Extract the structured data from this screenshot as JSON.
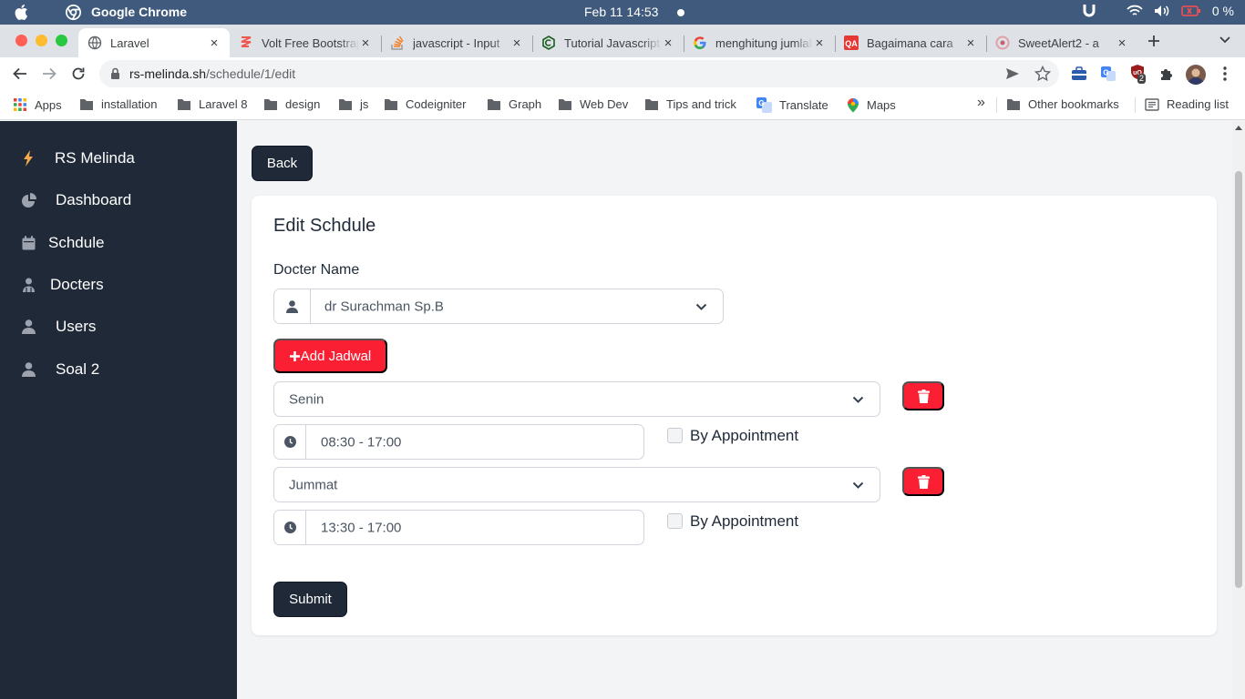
{
  "menubar": {
    "app_name": "Google Chrome",
    "clock": "Feb 11  14:53",
    "battery": "0 %"
  },
  "tabs": [
    {
      "title": "Laravel",
      "icon": "globe-icon",
      "active": true
    },
    {
      "title": "Volt Free Bootstrap",
      "icon": "volt-icon"
    },
    {
      "title": "javascript - Input",
      "icon": "stackoverflow-icon"
    },
    {
      "title": "Tutorial Javascript",
      "icon": "codepolitan-icon"
    },
    {
      "title": "menghitung jumlah",
      "icon": "google-icon"
    },
    {
      "title": "Bagaimana cara",
      "icon": "qa-icon"
    },
    {
      "title": "SweetAlert2 - a",
      "icon": "sweetalert-icon"
    }
  ],
  "address": {
    "host": "rs-melinda.sh",
    "path": "/schedule/1/edit"
  },
  "extensions": {
    "badge": "2"
  },
  "bookmarks": [
    {
      "label": "Apps",
      "icon": "apps-grid-icon"
    },
    {
      "label": "installation",
      "icon": "folder-icon"
    },
    {
      "label": "Laravel 8",
      "icon": "folder-icon"
    },
    {
      "label": "design",
      "icon": "folder-icon"
    },
    {
      "label": "js",
      "icon": "folder-icon"
    },
    {
      "label": "Codeigniter",
      "icon": "folder-icon"
    },
    {
      "label": "Graph",
      "icon": "folder-icon"
    },
    {
      "label": "Web Dev",
      "icon": "folder-icon"
    },
    {
      "label": "Tips and trick",
      "icon": "folder-icon"
    },
    {
      "label": "Translate",
      "icon": "translate-icon"
    },
    {
      "label": "Maps",
      "icon": "maps-pin-icon"
    }
  ],
  "bookmarks_right": {
    "overflow": "»",
    "other": "Other bookmarks",
    "reading": "Reading list"
  },
  "sidebar": {
    "brand": "RS Melinda",
    "items": [
      {
        "label": "Dashboard",
        "icon": "pie-chart-icon"
      },
      {
        "label": "Schdule",
        "icon": "calendar-icon"
      },
      {
        "label": "Docters",
        "icon": "user-doctor-icon"
      },
      {
        "label": "Users",
        "icon": "user-icon"
      },
      {
        "label": "Soal 2",
        "icon": "user-icon"
      }
    ]
  },
  "page": {
    "back_label": "Back",
    "card_title": "Edit Schdule",
    "doctor_label": "Docter Name",
    "doctor_value": "dr Surachman Sp.B",
    "add_label": "Add Jadwal",
    "schedules": [
      {
        "day": "Senin",
        "time": "08:30 - 17:00",
        "appointment_label": "By Appointment",
        "appointment_checked": false
      },
      {
        "day": "Jummat",
        "time": "13:30 - 17:00",
        "appointment_label": "By Appointment",
        "appointment_checked": false
      }
    ],
    "submit_label": "Submit"
  },
  "colors": {
    "sidebar_bg": "#1f2937",
    "danger": "#fa1f33",
    "brand_bolt": "#f6a74c"
  }
}
